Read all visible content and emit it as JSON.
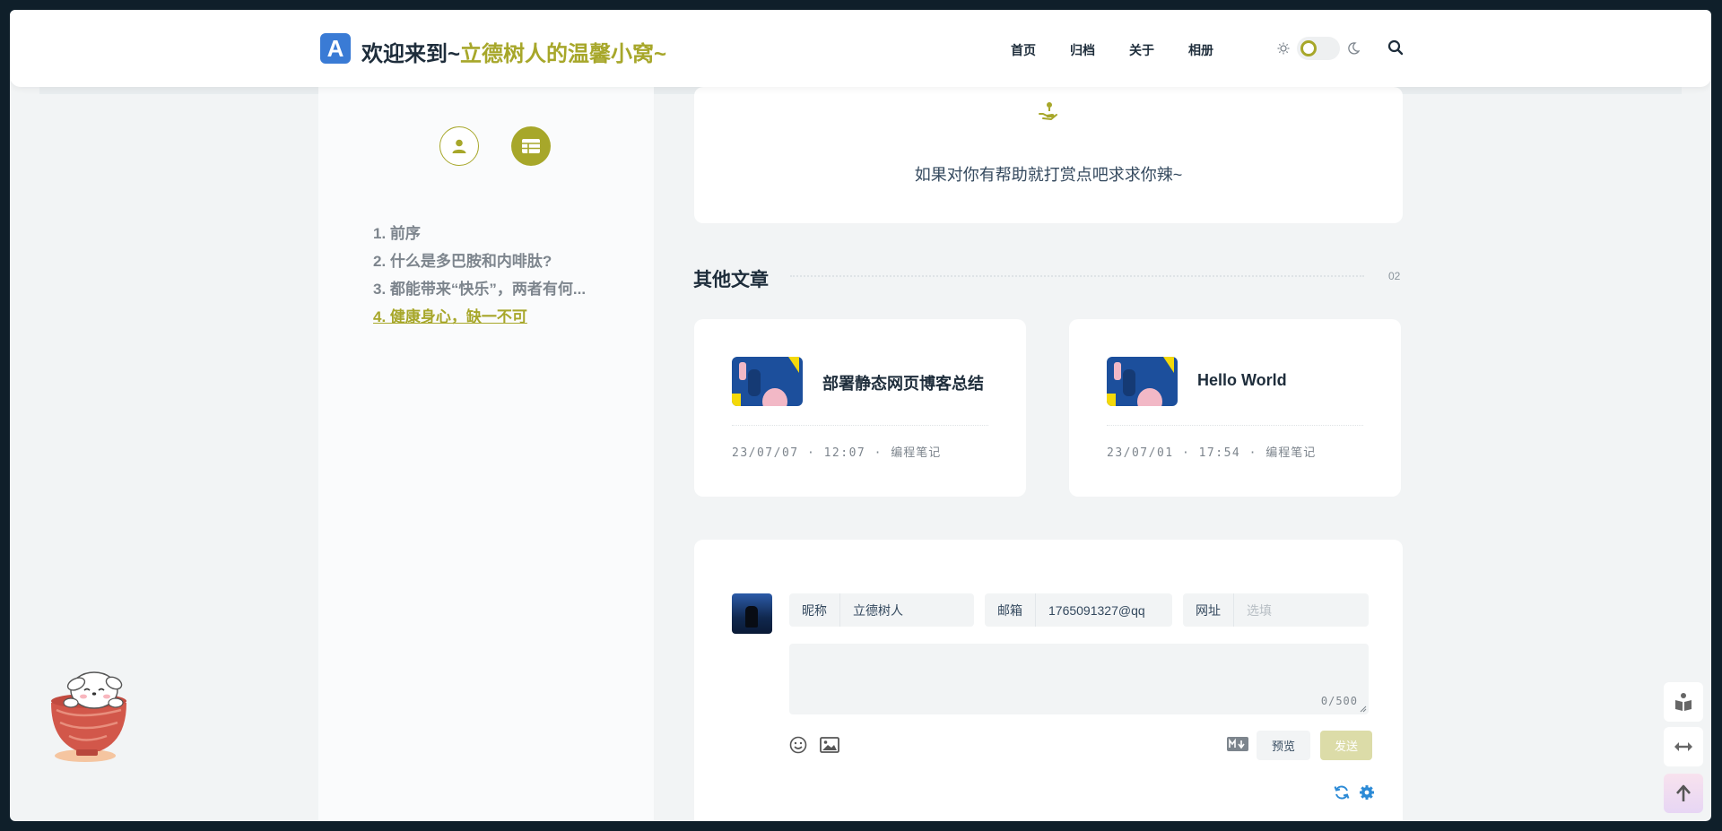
{
  "header": {
    "logo_letter": "A",
    "title_prefix": "欢迎来到~",
    "title_accent": "立德树人的温馨小窝~",
    "nav": [
      "首页",
      "归档",
      "关于",
      "相册"
    ],
    "theme_mode": "light"
  },
  "sidebar": {
    "toc": [
      "1. 前序",
      "2. 什么是多巴胺和内啡肽?",
      "3. 都能带来“快乐”，两者有何...",
      "4. 健康身心，缺一不可"
    ],
    "active_index": 3
  },
  "reward": {
    "text": "如果对你有帮助就打赏点吧求求你辣~"
  },
  "other_articles": {
    "title": "其他文章",
    "count": "02",
    "posts": [
      {
        "title": "部署静态网页博客总结",
        "date": "23/07/07",
        "time": "12:07",
        "category": "编程笔记"
      },
      {
        "title": "Hello World",
        "date": "23/07/01",
        "time": "17:54",
        "category": "编程笔记"
      }
    ]
  },
  "comment": {
    "nickname_label": "昵称",
    "nickname_value": "立德树人",
    "email_label": "邮箱",
    "email_value": "1765091327@qq",
    "url_label": "网址",
    "url_placeholder": "选填",
    "counter": "0/500",
    "preview_label": "预览",
    "send_label": "发送"
  },
  "colors": {
    "accent": "#a7a72a",
    "dark_text": "#1e2d3b",
    "background": "#f2f4f5"
  }
}
